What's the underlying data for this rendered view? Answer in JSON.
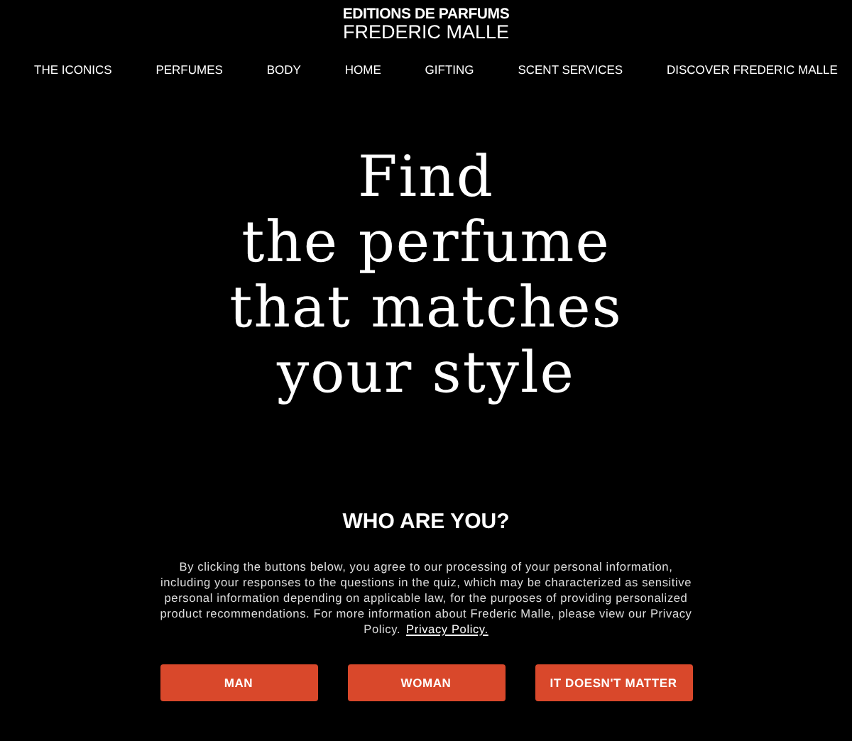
{
  "logo": {
    "line_1": "EDITIONS DE PARFUMS",
    "line_2": "FREDERIC MALLE"
  },
  "nav": [
    "THE ICONICS",
    "PERFUMES",
    "BODY",
    "HOME",
    "GIFTING",
    "SCENT SERVICES",
    "DISCOVER FREDERIC MALLE"
  ],
  "headline": [
    "Find",
    "the perfume",
    "that matches",
    "your style"
  ],
  "question": "WHO ARE YOU?",
  "consent": {
    "text": "By clicking the buttons below, you agree to our processing of your personal information, including your responses to the questions in the quiz, which may be characterized as sensitive personal information depending on applicable law, for the purposes of providing personalized product recommendations. For more information about Frederic Malle, please view our Privacy Policy.",
    "link": "Privacy Policy."
  },
  "buttons": [
    "MAN",
    "WOMAN",
    "IT DOESN'T MATTER"
  ]
}
